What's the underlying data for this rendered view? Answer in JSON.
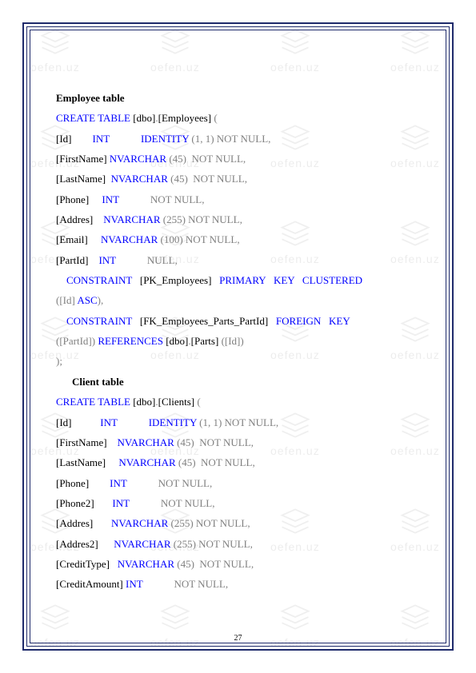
{
  "watermark_text": "oefen.uz",
  "page_number": "27",
  "headings": {
    "employee": "Employee table",
    "client": "Client table"
  },
  "sql": {
    "create_table": "CREATE TABLE",
    "int": "INT",
    "identity": "IDENTITY",
    "nvarchar": "NVARCHAR",
    "not_null": "NOT NULL",
    "null": "NULL",
    "constraint": "CONSTRAINT",
    "primary_key_clustered": "PRIMARY   KEY   CLUSTERED",
    "asc": "ASC",
    "foreign_key": "FOREIGN   KEY",
    "references": "REFERENCES"
  },
  "employees": {
    "schema": "[dbo]",
    "table": "[Employees]",
    "cols": {
      "id": "[Id]",
      "first": "[FirstName]",
      "last": "[LastName]",
      "phone": "[Phone]",
      "addres": "[Addres]",
      "email": "[Email]",
      "partid": "[PartId]"
    },
    "len45": "(45)",
    "len255": "(255)",
    "len100": "(100)",
    "identity_args": "(1, 1)",
    "pk": "[PK_Employees]",
    "fk": "[FK_Employees_Parts_PartId]",
    "pk_col": "([Id]",
    "fk_col": "([PartId])",
    "ref_schema": "[dbo]",
    "ref_table": "[Parts]",
    "ref_col": "([Id])"
  },
  "clients": {
    "schema": "[dbo]",
    "table": "[Clients]",
    "cols": {
      "id": "[Id]",
      "first": "[FirstName]",
      "last": "[LastName]",
      "phone": "[Phone]",
      "phone2": "[Phone2]",
      "addres": "[Addres]",
      "addres2": "[Addres2]",
      "credittype": "[CreditType]",
      "creditamount": "[CreditAmount]"
    },
    "len45": "(45)",
    "len255": "(255)",
    "identity_args": "(1, 1)"
  },
  "punct": {
    "open": "(",
    "close": ")",
    "comma": ",",
    "close_semi": ");",
    "close_comma": "),"
  }
}
